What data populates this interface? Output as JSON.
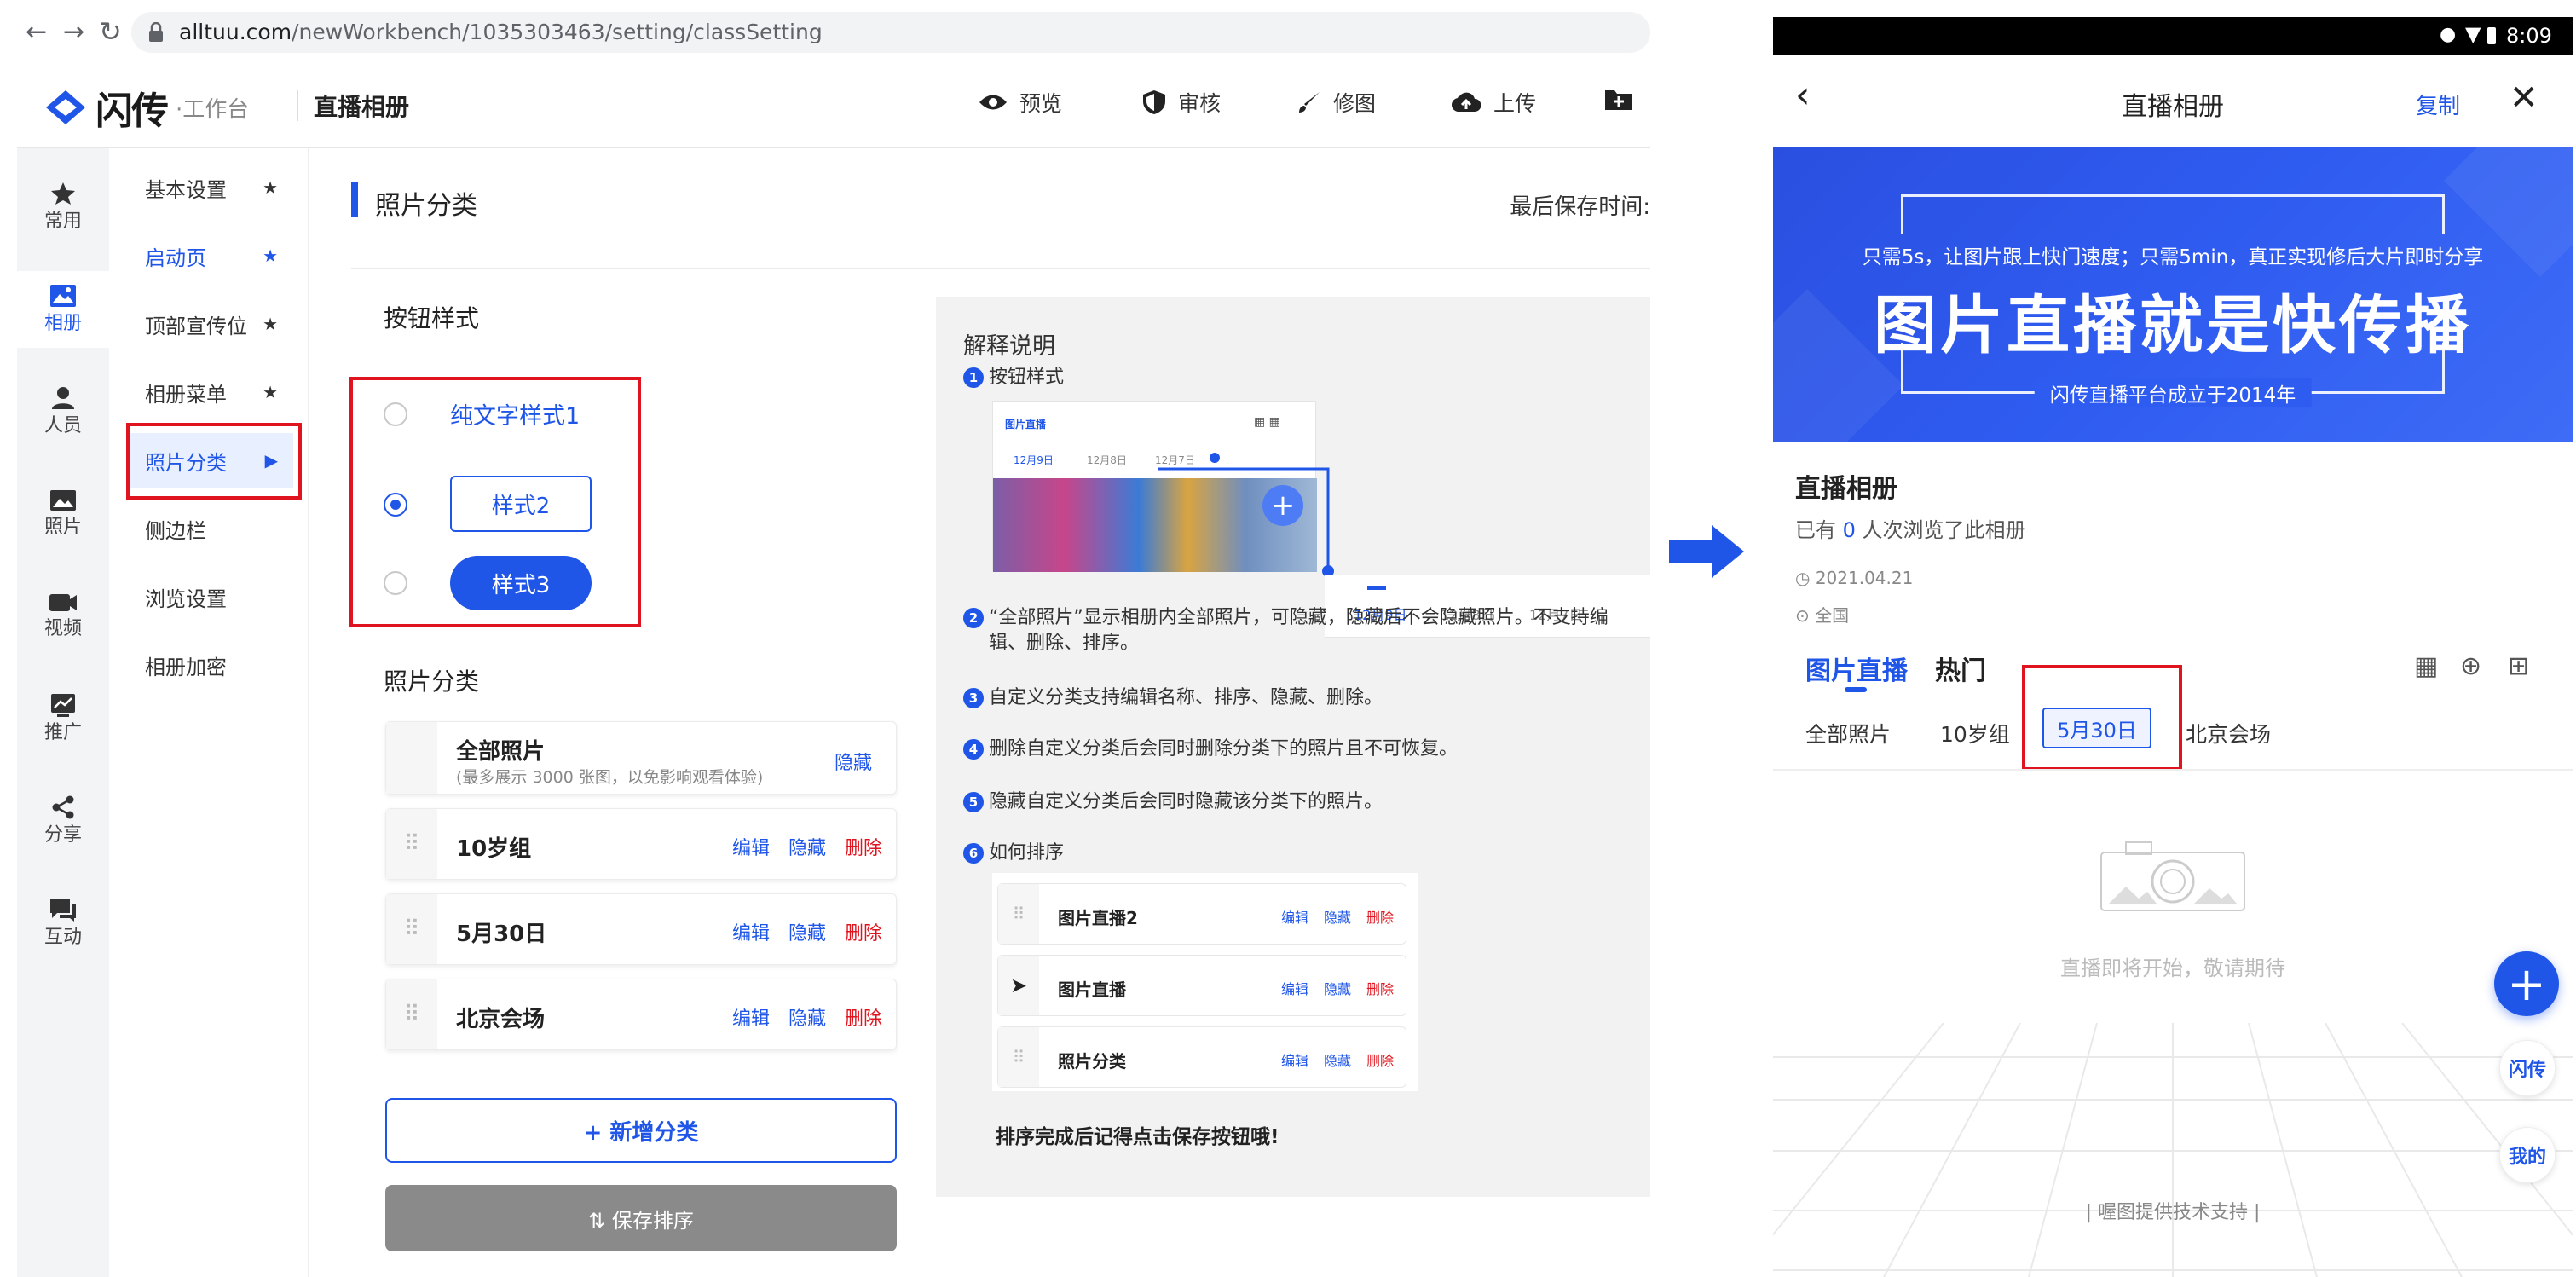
{
  "browser": {
    "url_host": "alltuu.com",
    "url_path": "/newWorkbench/1035303463/setting/classSetting"
  },
  "header": {
    "logo": "闪传",
    "logo_sub": "·工作台",
    "album_title": "直播相册",
    "actions": [
      {
        "icon": "eye-icon",
        "label": "预览"
      },
      {
        "icon": "shield-icon",
        "label": "审核"
      },
      {
        "icon": "brush-icon",
        "label": "修图"
      },
      {
        "icon": "cloud-upload-icon",
        "label": "上传"
      },
      {
        "icon": "folder-plus-icon",
        "label": ""
      }
    ]
  },
  "rail": [
    {
      "icon": "star-icon",
      "label": "常用"
    },
    {
      "icon": "album-icon",
      "label": "相册"
    },
    {
      "icon": "user-icon",
      "label": "人员"
    },
    {
      "icon": "image-icon",
      "label": "照片"
    },
    {
      "icon": "video-icon",
      "label": "视频"
    },
    {
      "icon": "chart-icon",
      "label": "推广"
    },
    {
      "icon": "share-icon",
      "label": "分享"
    },
    {
      "icon": "chat-icon",
      "label": "互动"
    }
  ],
  "submenu": [
    {
      "label": "基本设置",
      "starred": true
    },
    {
      "label": "启动页",
      "starred": true
    },
    {
      "label": "顶部宣传位",
      "starred": true
    },
    {
      "label": "相册菜单",
      "starred": true
    },
    {
      "label": "照片分类",
      "active": true
    },
    {
      "label": "侧边栏"
    },
    {
      "label": "浏览设置"
    },
    {
      "label": "相册加密"
    }
  ],
  "content": {
    "section_title": "照片分类",
    "last_saved": "最后保存时间:",
    "button_style_label": "按钮样式",
    "style_options": [
      "纯文字样式1",
      "样式2",
      "样式3"
    ],
    "selected_style": "样式2",
    "category_label": "照片分类",
    "all_photos": {
      "name": "全部照片",
      "note": "(最多展示 3000 张图，以免影响观看体验)",
      "action": "隐藏"
    },
    "categories": [
      {
        "name": "10岁组"
      },
      {
        "name": "5月30日"
      },
      {
        "name": "北京会场"
      }
    ],
    "row_actions": {
      "edit": "编辑",
      "hide": "隐藏",
      "delete": "删除"
    },
    "add_category": "+ 新增分类",
    "save_sort": "⇅ 保存排序"
  },
  "explain": {
    "title": "解释说明",
    "items": [
      {
        "num": "1",
        "text": "按钮样式"
      },
      {
        "num": "2",
        "text": "“全部照片”显示相册内全部照片，可隐藏，隐藏后不会隐藏照片。不支持编辑、删除、排序。"
      },
      {
        "num": "3",
        "text": "自定义分类支持编辑名称、排序、隐藏、删除。"
      },
      {
        "num": "4",
        "text": "删除自定义分类后会同时删除分类下的照片且不可恢复。"
      },
      {
        "num": "5",
        "text": "隐藏自定义分类后会同时隐藏该分类下的照片。"
      },
      {
        "num": "6",
        "text": "如何排序"
      }
    ],
    "mini_preview": {
      "title": "图片直播",
      "dates": [
        "12月9日",
        "12月8日",
        "12月7日"
      ]
    },
    "zoom_dates": [
      "12月9日",
      "12月8日",
      "12月7日"
    ],
    "sort_rows": [
      "图片直播2",
      "图片直播",
      "照片分类"
    ],
    "footer": "排序完成后记得点击保存按钮哦!"
  },
  "phone": {
    "time": "8:09",
    "nav_title": "直播相册",
    "nav_copy": "复制",
    "banner_sub": "只需5s，让图片跟上快门速度；只需5min，真正实现修后大片即时分享",
    "banner_main": "图片直播就是快传播",
    "banner_foot": "闪传直播平台成立于2014年",
    "album_name": "直播相册",
    "views_prefix": "已有 ",
    "views_count": "0",
    "views_suffix": " 人次浏览了此相册",
    "date": "2021.04.21",
    "location": "全国",
    "tabs": [
      "图片直播",
      "热门"
    ],
    "subtabs": [
      "全部照片",
      "10岁组",
      "5月30日",
      "北京会场"
    ],
    "active_subtab": "5月30日",
    "empty_text": "直播即将开始，敬请期待",
    "fab_labels": [
      "闪传",
      "我的"
    ],
    "tech_support": "| 喔图提供技术支持 |"
  },
  "colors": {
    "accent": "#1f56e8",
    "highlight_box": "#e0141e",
    "banner_blue": "#2f5cf0"
  }
}
